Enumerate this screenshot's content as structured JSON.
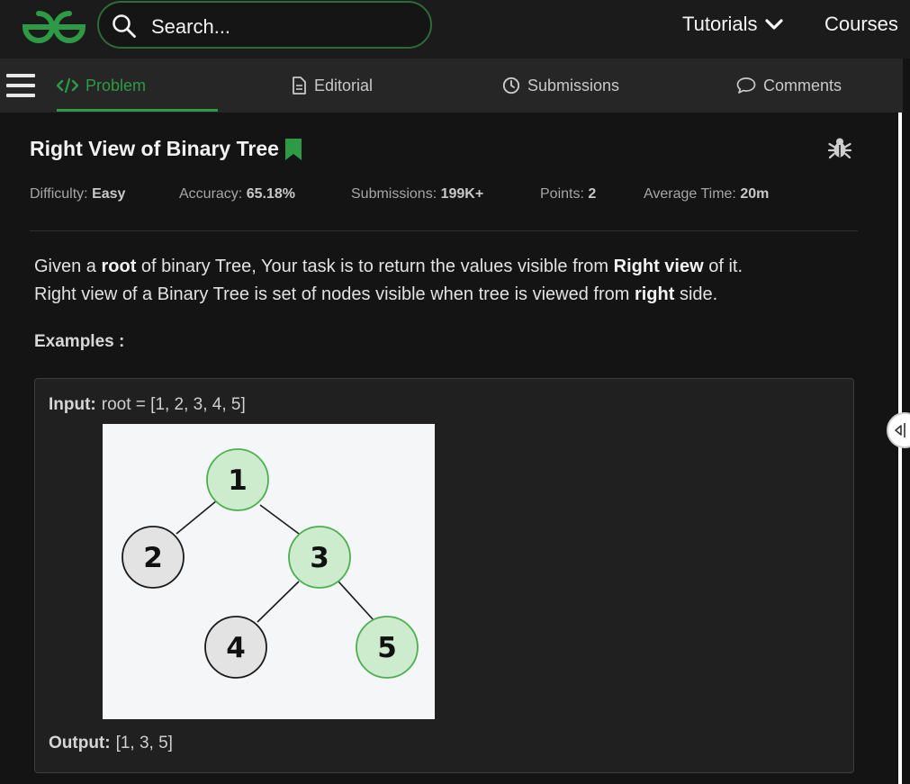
{
  "header": {
    "logo_icon": "gfg-logo-icon",
    "search_placeholder": "Search...",
    "nav": {
      "tutorials": "Tutorials",
      "courses": "Courses"
    },
    "brand_color": "#2f9a45"
  },
  "tabs": [
    {
      "label": "Problem",
      "icon": "code-icon",
      "active": true
    },
    {
      "label": "Editorial",
      "icon": "document-icon",
      "active": false
    },
    {
      "label": "Submissions",
      "icon": "clock-icon",
      "active": false
    },
    {
      "label": "Comments",
      "icon": "comment-icon",
      "active": false
    }
  ],
  "problem": {
    "title": "Right View of Binary Tree",
    "meta": [
      {
        "label": "Difficulty: ",
        "value": "Easy"
      },
      {
        "label": "Accuracy: ",
        "value": "65.18%"
      },
      {
        "label": "Submissions: ",
        "value": "199K+"
      },
      {
        "label": "Points: ",
        "value": "2"
      },
      {
        "label": "Average Time: ",
        "value": "20m"
      }
    ],
    "desc": {
      "l1a": "Given a ",
      "l1b": "root",
      "l1c": " of  binary Tree, Your task is to return the values visible from ",
      "l1d": "Right view",
      "l1e": " of it.",
      "l2a": "Right view of a Binary Tree is set of nodes visible when tree is viewed from ",
      "l2b": "right",
      "l2c": " side."
    },
    "examples_heading": "Examples :",
    "example": {
      "input_label": "Input:",
      "input_value": "root  =  [1,  2,  3,  4,  5]",
      "output_label": "Output:",
      "output_value": "[1,  3,  5]",
      "tree_nodes": [
        {
          "value": "1",
          "visible_from_right": true
        },
        {
          "value": "2",
          "visible_from_right": false
        },
        {
          "value": "3",
          "visible_from_right": true
        },
        {
          "value": "4",
          "visible_from_right": false
        },
        {
          "value": "5",
          "visible_from_right": true
        }
      ],
      "highlight_color": "#cdeccd",
      "plain_color": "#e3e3e3"
    }
  }
}
